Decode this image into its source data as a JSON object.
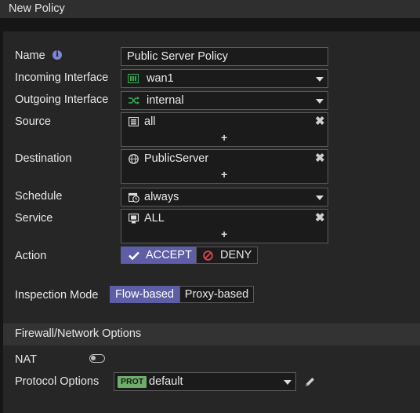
{
  "window": {
    "title": "New Policy"
  },
  "form": {
    "name": {
      "label": "Name",
      "value": "Public Server Policy"
    },
    "incoming_interface": {
      "label": "Incoming Interface",
      "value": "wan1"
    },
    "outgoing_interface": {
      "label": "Outgoing Interface",
      "value": "internal"
    },
    "source": {
      "label": "Source",
      "value": "all"
    },
    "destination": {
      "label": "Destination",
      "value": "PublicServer"
    },
    "schedule": {
      "label": "Schedule",
      "value": "always"
    },
    "service": {
      "label": "Service",
      "value": "ALL"
    },
    "action": {
      "label": "Action",
      "accept": "ACCEPT",
      "deny": "DENY",
      "selected": "ACCEPT"
    },
    "inspection_mode": {
      "label": "Inspection Mode",
      "flow": "Flow-based",
      "proxy": "Proxy-based",
      "selected": "Flow-based"
    }
  },
  "firewall_options": {
    "title": "Firewall/Network Options",
    "nat": {
      "label": "NAT",
      "enabled": false
    },
    "protocol_options": {
      "label": "Protocol Options",
      "badge": "PROT",
      "value": "default"
    }
  },
  "colors": {
    "accent": "#5e5ea6",
    "interface_icon": "#2fa84f",
    "prot_badge": "#6fae6a"
  }
}
